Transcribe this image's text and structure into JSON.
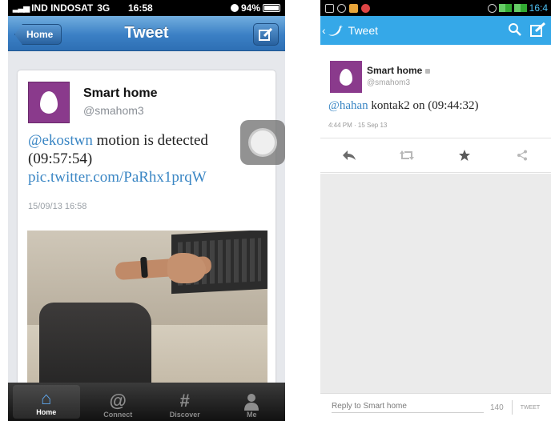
{
  "ios": {
    "status": {
      "carrier": "IND INDOSAT",
      "network": "3G",
      "time": "16:58",
      "battery": "94%"
    },
    "nav": {
      "back_label": "Home",
      "title": "Tweet"
    },
    "tweet": {
      "name": "Smart home",
      "handle": "@smahom3",
      "mention": "@ekostwn",
      "text": " motion is detected (09:57:54) ",
      "link": "pic.twitter.com/PaRhx1prqW",
      "date": "15/09/13 16:58"
    },
    "tabs": [
      {
        "label": "Home",
        "icon": "home-icon"
      },
      {
        "label": "Connect",
        "icon": "at-icon"
      },
      {
        "label": "Discover",
        "icon": "hash-icon"
      },
      {
        "label": "Me",
        "icon": "person-icon"
      }
    ],
    "tab_glyphs": [
      "⌂",
      "@",
      "#",
      "👤"
    ]
  },
  "android": {
    "status": {
      "time": "16:4"
    },
    "bar": {
      "title": "Tweet"
    },
    "tweet": {
      "name": "Smart home",
      "handle": "@smahom3",
      "mention": "@hahan",
      "text": " kontak2 on (09:44:32)",
      "date": "4:44 PM · 15 Sep 13"
    },
    "reply": {
      "placeholder": "Reply to Smart home",
      "count": "140",
      "send": "TWEET"
    }
  },
  "colors": {
    "ios_nav": "#3b80c5",
    "twitter_blue": "#35a8e8",
    "link": "#3a86c4",
    "avatar": "#8a3a8c"
  }
}
